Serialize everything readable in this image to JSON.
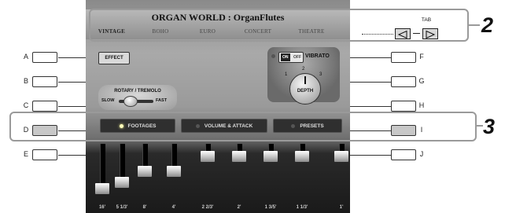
{
  "screen": {
    "title": "ORGAN WORLD : OrganFlutes",
    "tabs": [
      {
        "label": "VINTAGE",
        "active": true
      },
      {
        "label": "BOHO",
        "active": false
      },
      {
        "label": "EURO",
        "active": false
      },
      {
        "label": "CONCERT",
        "active": false
      },
      {
        "label": "THEATRE",
        "active": false
      }
    ],
    "effect_button": "EFFECT",
    "vibrato": {
      "on_label": "ON",
      "off_label": "OFF",
      "label": "VIBRATO",
      "depth_label": "DEPTH",
      "depth_marks": [
        "1",
        "2",
        "3"
      ]
    },
    "rotary": {
      "label": "ROTARY / TREMOLO",
      "slow": "SLOW",
      "fast": "FAST"
    },
    "row_buttons": [
      {
        "label": "FOOTAGES",
        "led_on": true
      },
      {
        "label": "VOLUME & ATTACK",
        "led_on": false
      },
      {
        "label": "PRESETS",
        "led_on": false
      }
    ],
    "footages": [
      {
        "label": "16'",
        "level": 0.75
      },
      {
        "label": "5 1/3'",
        "level": 0.6
      },
      {
        "label": "8'",
        "level": 0.35
      },
      {
        "label": "4'",
        "level": 0.35
      },
      {
        "label": "2 2/3'",
        "level": 0.0
      },
      {
        "label": "2'",
        "level": 0.0
      },
      {
        "label": "1 3/5'",
        "level": 0.0
      },
      {
        "label": "1 1/3'",
        "level": 0.0
      },
      {
        "label": "1'",
        "level": 0.0
      }
    ]
  },
  "left_keys": [
    "A",
    "B",
    "C",
    "D",
    "E"
  ],
  "right_keys": [
    "F",
    "G",
    "H",
    "I",
    "J"
  ],
  "tab_area": {
    "label": "TAB",
    "left_icon": "triangle-left-icon",
    "right_icon": "triangle-right-icon"
  },
  "callouts": [
    "2",
    "3"
  ]
}
